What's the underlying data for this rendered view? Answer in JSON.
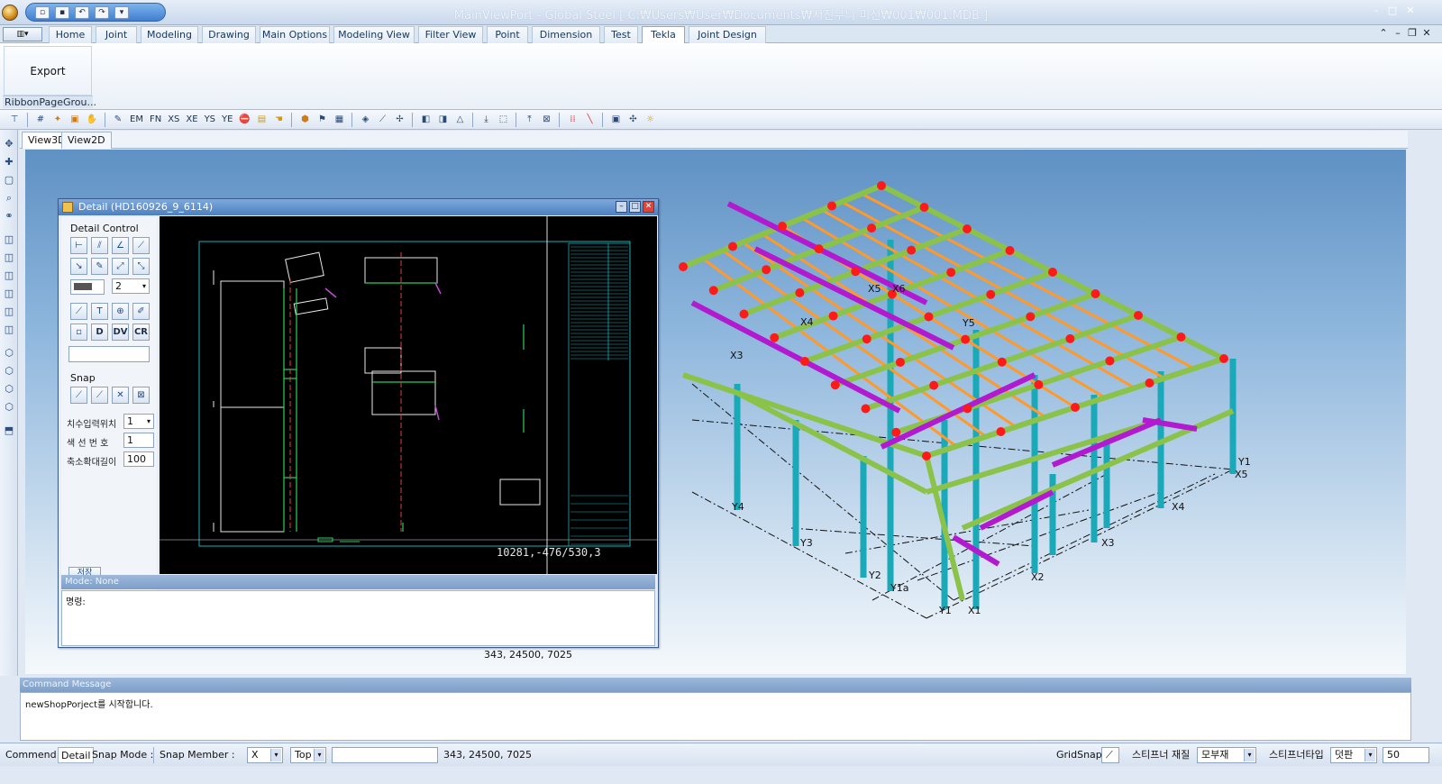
{
  "window": {
    "title": "MainViewPort - Global Steel  [ C:₩Users₩User₩Documents₩서진무늬 미션₩001₩001.MDB ]"
  },
  "tabs": [
    "Home",
    "Joint",
    "Modeling",
    "Drawing",
    "Main Options",
    "Modeling View",
    "Filter View",
    "Point",
    "Dimension",
    "Test",
    "Tekla",
    "Joint Design"
  ],
  "active_tab": "Tekla",
  "ribbon": {
    "export_label": "Export",
    "group_label": "RibbonPageGrou..."
  },
  "toolbar": {
    "labels": [
      "EM",
      "FN",
      "XS",
      "XE",
      "YS",
      "YE"
    ]
  },
  "doc_tabs": [
    "View3D",
    "View2D"
  ],
  "detail": {
    "title": "Detail  (HD160926_9_6114)",
    "control_label": "Detail Control",
    "line_width": "2",
    "buttons": [
      "D",
      "DV",
      "CR"
    ],
    "snap_label": "Snap",
    "fields": [
      {
        "label": "치수입력위치",
        "value": "1"
      },
      {
        "label": "색 선 번 호",
        "value": "1"
      },
      {
        "label": "축소확대길이",
        "value": "100"
      }
    ],
    "save_button": "저장",
    "cad_coord": "10281,-476/530,3",
    "mode_label": "Mode: None",
    "command_prompt": "명령:"
  },
  "viewport": {
    "coord": "343, 24500, 7025",
    "grid_labels": [
      "X1",
      "X2",
      "X3",
      "X4",
      "X5",
      "X6",
      "Y1",
      "Y1a",
      "Y2",
      "Y3",
      "Y4",
      "Y5"
    ]
  },
  "command": {
    "title": "Command Message",
    "text": "newShopPorject를 시작합니다."
  },
  "status": {
    "command_label": "Commend :",
    "command_value": "Detail",
    "snap_mode": "Snap Mode :",
    "snap_member": "Snap Member :",
    "axis": "X",
    "view": "Top",
    "coord": "343, 24500, 7025",
    "gridsnap": "GridSnap:",
    "stiffener_material_label": "스티프너 재질",
    "stiffener_material_value": "모부재",
    "stiffener_type_label": "스티프너타입",
    "stiffener_type_value": "덧판",
    "value": "50"
  },
  "colors": {
    "ribbon_blue": "#dbe6f3",
    "viewport_top": "#5f91c4",
    "member_green": "#8bc34a",
    "purlin_orange": "#ff9a2a",
    "brace_magenta": "#b21ad0",
    "column_cyan": "#1aa9b8",
    "node_red": "#ff1a1a"
  }
}
